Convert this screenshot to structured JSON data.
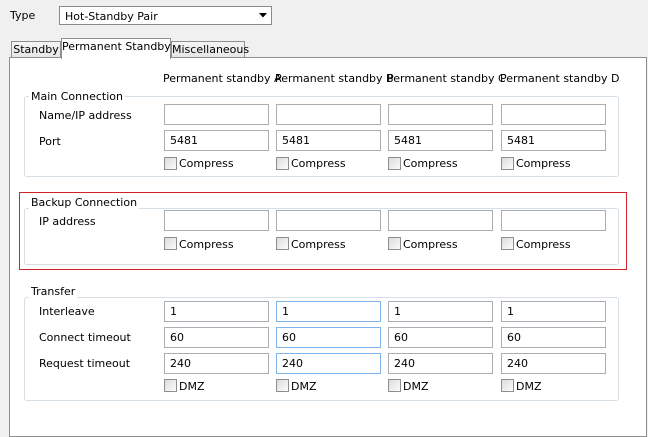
{
  "type_label": "Type",
  "type_select": {
    "value": "Hot-Standby Pair"
  },
  "tabs": [
    {
      "label": "Standby",
      "active": false
    },
    {
      "label": "Permanent Standby",
      "active": true
    },
    {
      "label": "Miscellaneous",
      "active": false
    }
  ],
  "columns": [
    "Permanent standby A",
    "Permanent standby B",
    "Permanent standby C",
    "Permanent standby D"
  ],
  "main_connection": {
    "title": "Main Connection",
    "name_label": "Name/IP address",
    "port_label": "Port",
    "names": [
      "",
      "",
      "",
      ""
    ],
    "ports": [
      "5481",
      "5481",
      "5481",
      "5481"
    ],
    "compress_label": "Compress"
  },
  "backup_connection": {
    "title": "Backup Connection",
    "ip_label": "IP address",
    "ips": [
      "",
      "",
      "",
      ""
    ],
    "compress_label": "Compress"
  },
  "transfer": {
    "title": "Transfer",
    "interleave_label": "Interleave",
    "connect_timeout_label": "Connect timeout",
    "request_timeout_label": "Request timeout",
    "interleave": [
      "1",
      "1",
      "1",
      "1"
    ],
    "connect_timeout": [
      "60",
      "60",
      "60",
      "60"
    ],
    "request_timeout": [
      "240",
      "240",
      "240",
      "240"
    ],
    "dmz_label": "DMZ"
  },
  "colors": {
    "highlight": "#d0232a",
    "group_border": "#d5dfe5",
    "focus_border": "#7eb4ea"
  }
}
